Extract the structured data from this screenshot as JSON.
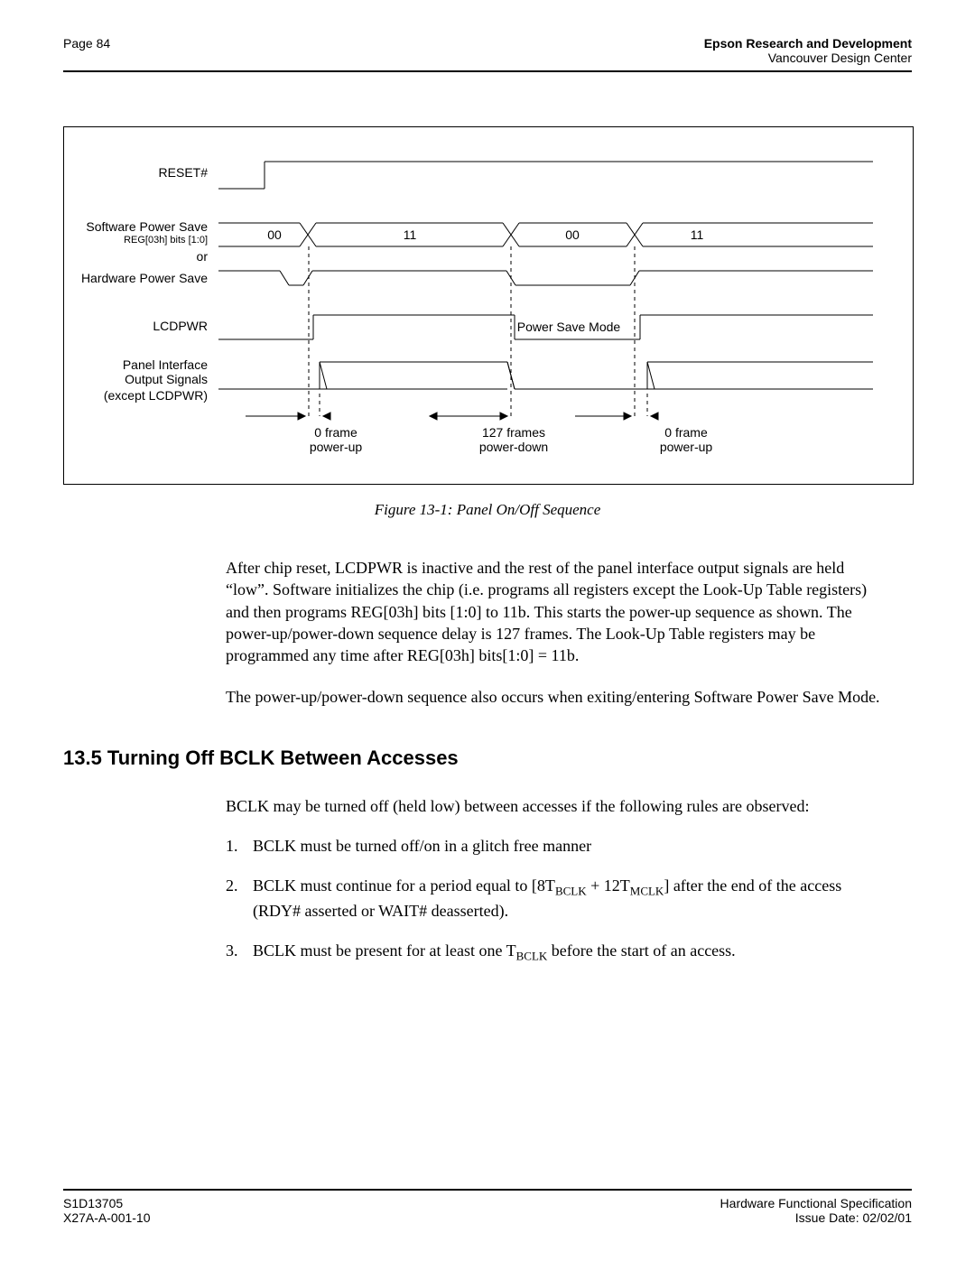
{
  "header": {
    "page_label": "Page 84",
    "company": "Epson Research and Development",
    "location": "Vancouver Design Center"
  },
  "diagram": {
    "labels": {
      "reset": "RESET#",
      "sw_power_save": "Software Power Save",
      "reg_bits": "REG[03h] bits [1:0]",
      "or": "or",
      "hw_power_save": "Hardware Power Save",
      "lcdpwr": "LCDPWR",
      "panel_if_1": "Panel Interface",
      "panel_if_2": "Output Signals",
      "panel_if_3": "(except LCDPWR)",
      "power_save_mode": "Power Save Mode"
    },
    "data_values": {
      "v1": "00",
      "v2": "11",
      "v3": "00",
      "v4": "11"
    },
    "callouts": {
      "c1_line1": "0 frame",
      "c1_line2": "power-up",
      "c2_line1": "127 frames",
      "c2_line2": "power-down",
      "c3_line1": "0 frame",
      "c3_line2": "power-up"
    },
    "caption": "Figure 13-1: Panel On/Off Sequence"
  },
  "paragraphs": {
    "p1": "After chip reset, LCDPWR is inactive and the rest of the panel interface output signals are held “low”. Software initializes the chip (i.e. programs all registers except the Look-Up Table registers) and then programs REG[03h] bits [1:0] to 11b. This starts the power-up sequence as shown. The power-up/power-down sequence delay is 127 frames. The Look-Up Table registers may be programmed any time after REG[03h] bits[1:0] = 11b.",
    "p2": "The power-up/power-down sequence also occurs when exiting/entering Software Power Save Mode."
  },
  "section": {
    "heading": "13.5  Turning Off BCLK Between Accesses",
    "intro": "BCLK may be turned off (held low) between accesses if the following rules are observed:",
    "item1": "BCLK must be turned off/on in a glitch free manner",
    "item2_pre": "BCLK must continue for a period equal to [8T",
    "item2_sub1": "BCLK",
    "item2_mid": " + 12T",
    "item2_sub2": "MCLK",
    "item2_post": "] after the end of the access (RDY# asserted or WAIT# deasserted).",
    "item3_pre": "BCLK must be present for at least one T",
    "item3_sub": "BCLK",
    "item3_post": " before the start of an access."
  },
  "footer": {
    "left1": "S1D13705",
    "left2": "X27A-A-001-10",
    "right1": "Hardware Functional Specification",
    "right2": "Issue Date: 02/02/01"
  }
}
